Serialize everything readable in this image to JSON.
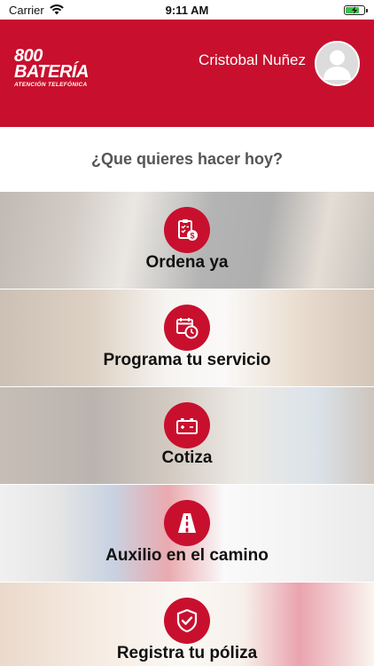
{
  "status_bar": {
    "carrier": "Carrier",
    "time": "9:11 AM"
  },
  "header": {
    "logo": {
      "line1": "800",
      "line2": "BATERÍA",
      "tagline": "ATENCIÓN TELEFÓNICA"
    },
    "user_name": "Cristobal Nuñez"
  },
  "question": "¿Que quieres hacer hoy?",
  "menu": [
    {
      "label": "Ordena ya",
      "icon": "clipboard-dollar-icon"
    },
    {
      "label": "Programa tu servicio",
      "icon": "calendar-clock-icon"
    },
    {
      "label": "Cotiza",
      "icon": "battery-icon"
    },
    {
      "label": "Auxilio en el camino",
      "icon": "road-icon"
    },
    {
      "label": "Registra tu póliza",
      "icon": "shield-check-icon"
    }
  ],
  "colors": {
    "brand_red": "#c8102e",
    "text_dark": "#111111",
    "question_gray": "#555555"
  }
}
